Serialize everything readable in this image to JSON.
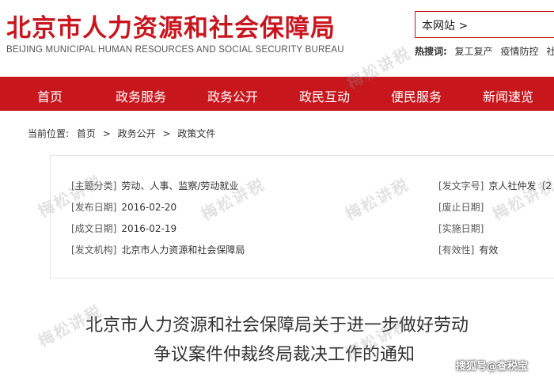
{
  "header": {
    "title": "北京市人力资源和社会保障局",
    "subtitle": "BEIJING MUNICIPAL HUMAN RESOURCES AND SOCIAL SECURITY BUREAU",
    "search_scope": "本网站 >",
    "hot_search_label": "热搜词:",
    "hot_search_items": [
      "复工复产",
      "疫情防控",
      "社"
    ]
  },
  "nav": {
    "items": [
      "首页",
      "政务服务",
      "政务公开",
      "政民互动",
      "便民服务",
      "新闻速览"
    ]
  },
  "breadcrumb": {
    "label": "当前位置:",
    "items": [
      "首页",
      "政务公开",
      "政策文件"
    ],
    "separator": ">"
  },
  "meta": {
    "subject_category": {
      "key": "[主题分类]",
      "value": "劳动、人事、监察/劳动就业"
    },
    "publish_date": {
      "key": "[发布日期]",
      "value": "2016-02-20"
    },
    "written_date": {
      "key": "[成文日期]",
      "value": "2016-02-19"
    },
    "issuing_body": {
      "key": "[发文机构]",
      "value": "北京市人力资源和社会保障局"
    },
    "doc_number": {
      "key": "[发文字号]",
      "value": "京人社仲发〔2"
    },
    "repeal_date": {
      "key": "[废止日期]",
      "value": ""
    },
    "effective_date": {
      "key": "[实施日期]",
      "value": ""
    },
    "validity": {
      "key": "[有效性]",
      "value": "有效"
    }
  },
  "article": {
    "title_line1": "北京市人力资源和社会保障局关于进一步做好劳动",
    "title_line2": "争议案件仲裁终局裁决工作的通知"
  },
  "watermark": {
    "text": "梅松讲税",
    "source": "搜狐号@查税宝"
  },
  "colors": {
    "brand_red": "#c8161d",
    "title_red": "#c9151e"
  }
}
